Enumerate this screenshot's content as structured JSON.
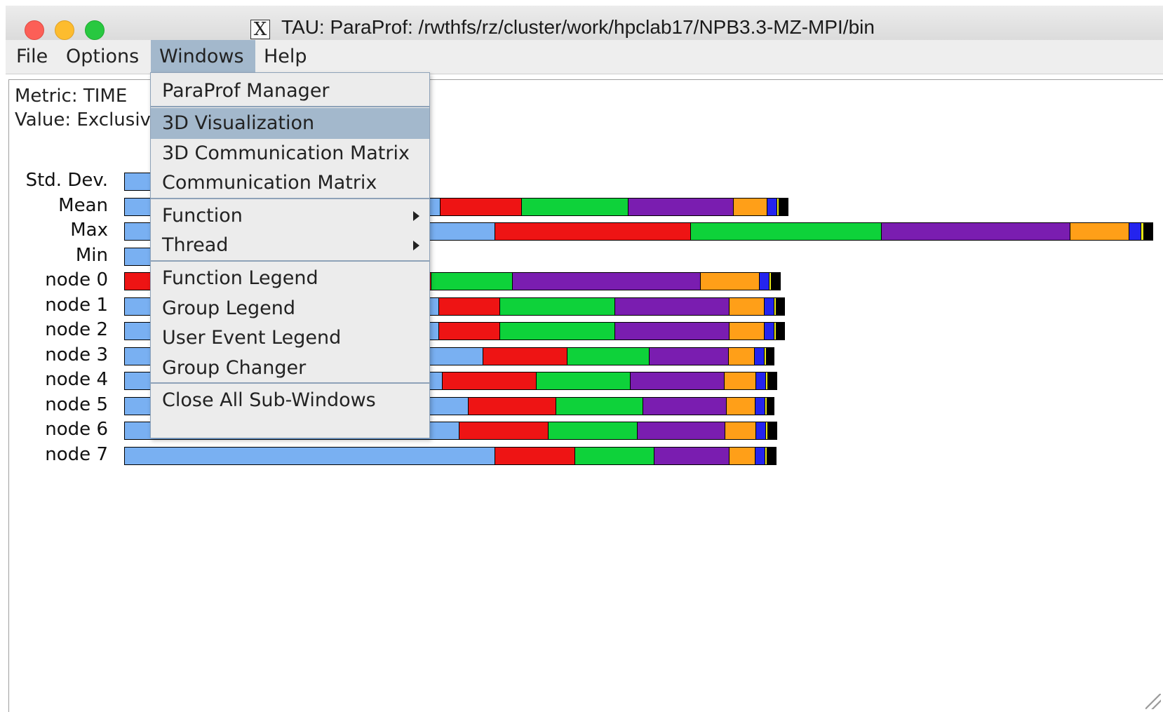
{
  "window": {
    "title": "TAU: ParaProf: /rwthfs/rz/cluster/work/hpclab17/NPB3.3-MZ-MPI/bin"
  },
  "menubar": {
    "file": "File",
    "options": "Options",
    "windows": "Windows",
    "help": "Help"
  },
  "windows_menu": {
    "items": [
      {
        "label": "ParaProf Manager"
      },
      {
        "label": "3D Visualization",
        "selected": true
      },
      {
        "label": "3D Communication Matrix"
      },
      {
        "label": "Communication Matrix"
      },
      {
        "label": "Function",
        "submenu": true
      },
      {
        "label": "Thread",
        "submenu": true
      },
      {
        "label": "Function Legend"
      },
      {
        "label": "Group Legend"
      },
      {
        "label": "User Event Legend"
      },
      {
        "label": "Group Changer"
      },
      {
        "label": "Close All Sub-Windows"
      }
    ]
  },
  "header": {
    "metric": "Metric: TIME",
    "value": "Value: Exclusive"
  },
  "colors": {
    "blue": "#79b0f2",
    "red": "#ee1414",
    "green": "#0ed23a",
    "purple": "#7a1db0",
    "orange": "#ff9f18",
    "dark_blue": "#2424ee",
    "yellow": "#e8e81a",
    "black": "#000000"
  },
  "chart_data": {
    "type": "bar",
    "stacked": true,
    "orientation": "horizontal",
    "metric": "TIME",
    "value_type": "Exclusive",
    "categories": [
      "Std. Dev.",
      "Mean",
      "Max",
      "Min",
      "node 0",
      "node 1",
      "node 2",
      "node 3",
      "node 4",
      "node 5",
      "node 6",
      "node 7"
    ],
    "segment_colors": [
      "blue",
      "red",
      "green",
      "purple",
      "orange",
      "dark_blue",
      "yellow",
      "black"
    ],
    "rows": [
      {
        "label": "Std. Dev.",
        "segments": [
          36
        ]
      },
      {
        "label": "Mean",
        "segments": [
          450,
          116,
          152,
          150,
          48,
          14,
          3,
          12
        ]
      },
      {
        "label": "Max",
        "segments": [
          528,
          279,
          272,
          269,
          84,
          17,
          4,
          12
        ]
      },
      {
        "label": "Min",
        "segments": [
          36
        ]
      },
      {
        "label": "node 0",
        "segments": [
          0,
          437,
          116,
          268,
          84,
          14,
          3,
          12
        ]
      },
      {
        "label": "node 1",
        "segments": [
          448,
          87,
          164,
          163,
          50,
          14,
          3,
          11
        ]
      },
      {
        "label": "node 2",
        "segments": [
          448,
          87,
          164,
          163,
          50,
          14,
          3,
          11
        ]
      },
      {
        "label": "node 3",
        "segments": [
          511,
          120,
          117,
          113,
          37,
          14,
          3,
          10
        ]
      },
      {
        "label": "node 4",
        "segments": [
          453,
          134,
          134,
          134,
          45,
          14,
          3,
          12
        ]
      },
      {
        "label": "node 5",
        "segments": [
          490,
          125,
          124,
          119,
          41,
          14,
          3,
          9
        ]
      },
      {
        "label": "node 6",
        "segments": [
          477,
          127,
          127,
          125,
          44,
          14,
          3,
          12
        ]
      },
      {
        "label": "node 7",
        "segments": [
          528,
          114,
          113,
          107,
          37,
          14,
          3,
          12
        ]
      }
    ]
  }
}
